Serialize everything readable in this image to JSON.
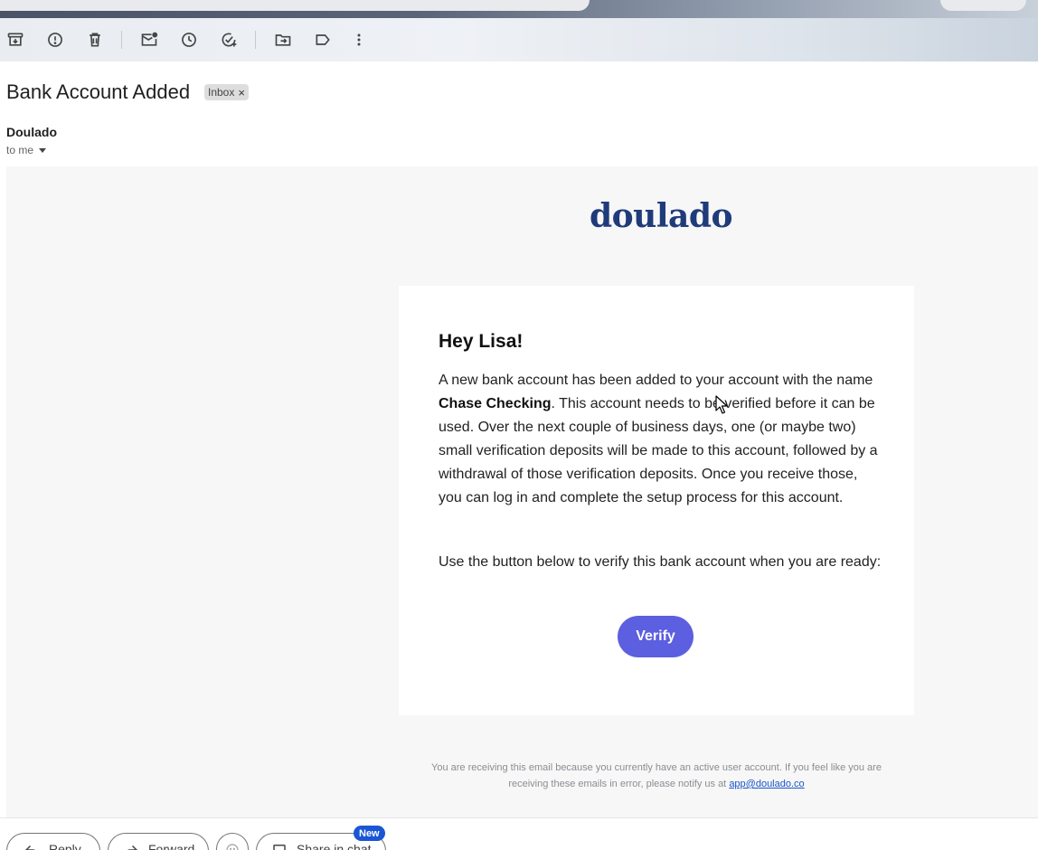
{
  "toolbar": {
    "buttons": [
      {
        "name": "archive",
        "icon": "archive-icon"
      },
      {
        "name": "report-spam",
        "icon": "report-spam-icon"
      },
      {
        "name": "delete",
        "icon": "trash-icon"
      },
      {
        "name": "mark-unread",
        "icon": "mark-unread-icon"
      },
      {
        "name": "snooze",
        "icon": "clock-icon"
      },
      {
        "name": "add-to-tasks",
        "icon": "add-task-icon"
      },
      {
        "name": "move-to",
        "icon": "move-to-folder-icon"
      },
      {
        "name": "labels",
        "icon": "label-icon"
      },
      {
        "name": "more",
        "icon": "more-vertical-icon"
      }
    ]
  },
  "email": {
    "subject": "Bank Account Added",
    "label_chip": "Inbox",
    "label_remove": "×",
    "sender": "Doulado",
    "recipient": "to me"
  },
  "body": {
    "logo": "doulado",
    "greeting": "Hey Lisa!",
    "para1_before": "A new bank account has been added to your account with the name ",
    "para1_bold": "Chase Checking",
    "para1_after": ". This account needs to be verified before it can be used. Over the next couple of business days, one (or maybe two) small verification deposits will be made to this account, followed by a withdrawal of those verification deposits. Once you receive those, you can log in and complete the setup process for this account.",
    "para2": "Use the button below to verify this bank account when you are ready:",
    "verify_button": "Verify",
    "footer_text": "You are receiving this email because you currently have an active user account. If you feel like you are receiving these emails in error, please notify us at ",
    "footer_link": "app@doulado.co"
  },
  "actions": {
    "reply": "Reply",
    "forward": "Forward",
    "share": "Share in chat",
    "new_badge": "New"
  },
  "colors": {
    "logo": "#1f3b7a",
    "verify_button": "#5b5fe0",
    "new_badge": "#1a56d4",
    "link": "#1a56c8"
  }
}
